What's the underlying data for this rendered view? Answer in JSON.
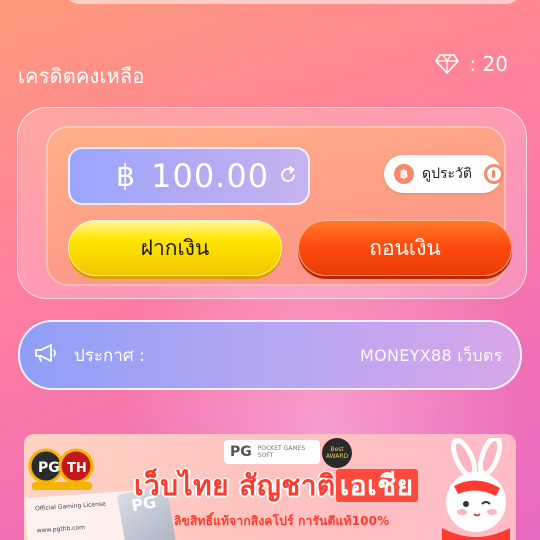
{
  "credit": {
    "label": "เครดิตคงเหลือ",
    "gem_count": ": 20"
  },
  "wallet": {
    "currency_symbol": "฿",
    "balance": "100.00",
    "history_label": "ดูประวัติ",
    "deposit_label": "ฝากเงิน",
    "withdraw_label": "ถอนเงิน"
  },
  "announcement": {
    "label": "ประกาศ :",
    "text": "MONEYX88 เว็บตร"
  },
  "banner": {
    "pg_text": "PG",
    "pg_small": "POCKET GAMES SOFT",
    "award_text": "Best AWARD",
    "title_part1": "เว็บไทย สัญชาติ",
    "title_part2": "เอเชีย",
    "subtitle": "ลิขสิทธิ์แท้จากสิงคโปร์ การันตีแท้100%",
    "card_text": "PG",
    "doc_line1": "Official Gaming License",
    "doc_line2": "www.pgthb.com"
  },
  "colors": {
    "bg_start": "#ff9a7a",
    "bg_end": "#e86ac2",
    "deposit": "#ffe500",
    "withdraw": "#ff4d0f",
    "balance_pill": "#9aa6ff"
  }
}
